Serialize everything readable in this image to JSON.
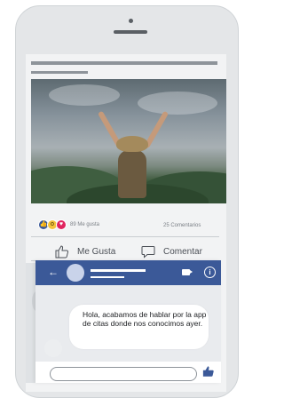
{
  "post": {
    "likes_text": "89 Me gusta",
    "comments_text": "25 Comentarios",
    "reactions": [
      "like-reaction",
      "wow-reaction",
      "love-reaction"
    ]
  },
  "actions": {
    "like_label": "Me Gusta",
    "comment_label": "Comentar"
  },
  "chat": {
    "message": "Hola, acabamos de hablar por la app de citas donde nos conocimos ayer.",
    "header_icons": [
      "back-arrow-icon",
      "video-camera-icon",
      "info-icon"
    ],
    "footer_icons": [
      "thumbs-up-icon"
    ]
  },
  "colors": {
    "header_blue": "#3b5998",
    "like_blue": "#3b5998",
    "love_red": "#e0245e",
    "wow_yellow": "#f5c33b"
  }
}
